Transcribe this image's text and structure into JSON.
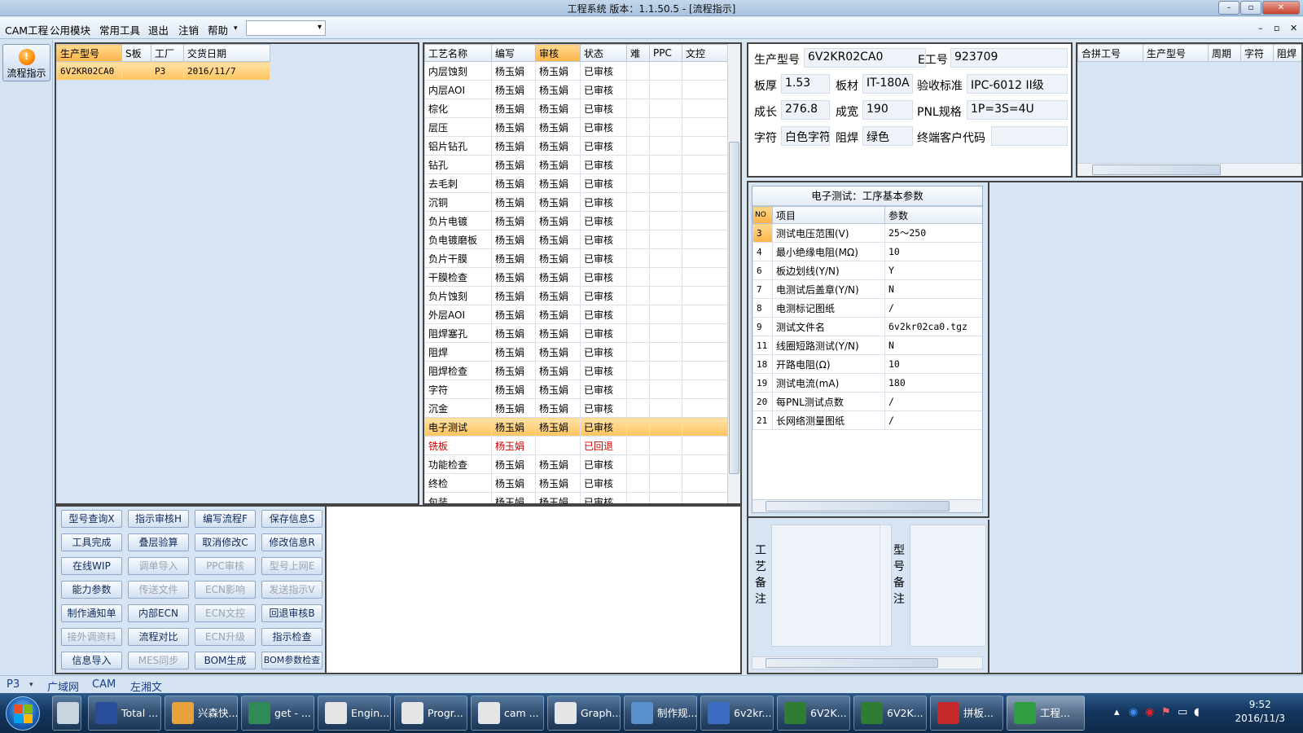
{
  "window": {
    "title": "工程系统  版本：1.1.50.5 - [流程指示]",
    "controls": [
      "–",
      "▫",
      "✕"
    ]
  },
  "menu": {
    "items": [
      "CAM工程",
      "公用模块",
      "常用工具",
      "退出",
      "注销",
      "帮助"
    ],
    "help_arrow": "▾",
    "combo_arrow": "▾",
    "mdi": [
      "–",
      "▫",
      "✕"
    ]
  },
  "sidebar": {
    "flow_label": "流程指示",
    "flow_icon": "!"
  },
  "model_list": {
    "headers": [
      "生产型号",
      "S板",
      "工厂",
      "交货日期"
    ],
    "rows": [
      [
        "6V2KR02CA0",
        "",
        "P3",
        "2016/11/7"
      ]
    ]
  },
  "process": {
    "headers": [
      "工艺名称",
      "编写",
      "审核",
      "状态",
      "难",
      "PPC",
      "文控"
    ],
    "rows": [
      [
        "内层蚀刻",
        "杨玉娟",
        "杨玉娟",
        "已审核"
      ],
      [
        "内层AOI",
        "杨玉娟",
        "杨玉娟",
        "已审核"
      ],
      [
        "棕化",
        "杨玉娟",
        "杨玉娟",
        "已审核"
      ],
      [
        "层压",
        "杨玉娟",
        "杨玉娟",
        "已审核"
      ],
      [
        "铝片钻孔",
        "杨玉娟",
        "杨玉娟",
        "已审核"
      ],
      [
        "钻孔",
        "杨玉娟",
        "杨玉娟",
        "已审核"
      ],
      [
        "去毛刺",
        "杨玉娟",
        "杨玉娟",
        "已审核"
      ],
      [
        "沉铜",
        "杨玉娟",
        "杨玉娟",
        "已审核"
      ],
      [
        "负片电镀",
        "杨玉娟",
        "杨玉娟",
        "已审核"
      ],
      [
        "负电镀磨板",
        "杨玉娟",
        "杨玉娟",
        "已审核"
      ],
      [
        "负片干膜",
        "杨玉娟",
        "杨玉娟",
        "已审核"
      ],
      [
        "干膜检查",
        "杨玉娟",
        "杨玉娟",
        "已审核"
      ],
      [
        "负片蚀刻",
        "杨玉娟",
        "杨玉娟",
        "已审核"
      ],
      [
        "外层AOI",
        "杨玉娟",
        "杨玉娟",
        "已审核"
      ],
      [
        "阻焊塞孔",
        "杨玉娟",
        "杨玉娟",
        "已审核"
      ],
      [
        "阻焊",
        "杨玉娟",
        "杨玉娟",
        "已审核"
      ],
      [
        "阻焊检查",
        "杨玉娟",
        "杨玉娟",
        "已审核"
      ],
      [
        "字符",
        "杨玉娟",
        "杨玉娟",
        "已审核"
      ],
      [
        "沉金",
        "杨玉娟",
        "杨玉娟",
        "已审核"
      ],
      [
        "电子测试",
        "杨玉娟",
        "杨玉娟",
        "已审核"
      ],
      [
        "铣板",
        "杨玉娟",
        "",
        "已回退"
      ],
      [
        "功能检查",
        "杨玉娟",
        "杨玉娟",
        "已审核"
      ],
      [
        "终检",
        "杨玉娟",
        "杨玉娟",
        "已审核"
      ],
      [
        "包装",
        "杨玉娟",
        "杨玉娟",
        "已审核"
      ]
    ],
    "selected_index": 19,
    "rejected_index": 20
  },
  "buttons": [
    [
      "型号查询X",
      "指示审核H",
      "编写流程F",
      "保存信息S"
    ],
    [
      "工具完成",
      "叠层验算",
      "取消修改C",
      "修改信息R"
    ],
    [
      "在线WIP",
      "调单导入",
      "PPC审核",
      "型号上网E"
    ],
    [
      "能力参数",
      "传送文件",
      "ECN影响",
      "发送指示V"
    ],
    [
      "制作通知单",
      "内部ECN",
      "ECN文控",
      "回退审核B"
    ],
    [
      "接外调资料",
      "流程对比",
      "ECN升级",
      "指示检查"
    ],
    [
      "信息导入",
      "MES同步",
      "BOM生成",
      "BOM参数检查"
    ]
  ],
  "disabled_buttons": [
    "调单导入",
    "PPC审核",
    "型号上网E",
    "传送文件",
    "ECN影响",
    "发送指示V",
    "ECN文控",
    "接外调资料",
    "ECN升级",
    "MES同步"
  ],
  "info": {
    "model_label": "生产型号",
    "model": "6V2KR02CA0",
    "eno_label": "E工号",
    "eno": "923709",
    "thick_label": "板厚",
    "thick": "1.53",
    "mat_label": "板材",
    "mat": "IT-180A",
    "std_label": "验收标准",
    "std": "IPC-6012 II级",
    "len_label": "成长",
    "len": "276.8",
    "wid_label": "成宽",
    "wid": "190",
    "pnl_label": "PNL规格",
    "pnl": "1P=3S=4U",
    "char_label": "字符",
    "char": "白色字符",
    "mask_label": "阻焊",
    "mask": "绿色",
    "cust_label": "终端客户代码",
    "cust": ""
  },
  "merge": {
    "headers": [
      "合拼工号",
      "生产型号",
      "周期",
      "字符",
      "阻焊"
    ]
  },
  "etest": {
    "title": "电子测试：工序基本参数",
    "headers": [
      "NO",
      "项目",
      "参数"
    ],
    "rows": [
      [
        "3",
        "测试电压范围(V)",
        "25～250"
      ],
      [
        "4",
        "最小绝缘电阻(MΩ)",
        "10"
      ],
      [
        "6",
        "板边划线(Y/N)",
        "Y"
      ],
      [
        "7",
        "电测试后盖章(Y/N)",
        "N"
      ],
      [
        "8",
        "电测标记图纸",
        "/"
      ],
      [
        "9",
        "测试文件名",
        "6v2kr02ca0.tgz"
      ],
      [
        "11",
        "线圈短路测试(Y/N)",
        "N"
      ],
      [
        "18",
        "开路电阻(Ω)",
        "10"
      ],
      [
        "19",
        "测试电流(mA)",
        "180"
      ],
      [
        "20",
        "每PNL测试点数",
        "/"
      ],
      [
        "21",
        "长网络测量图纸",
        "/"
      ]
    ]
  },
  "remarks": {
    "process_label": [
      "工",
      "艺",
      "备",
      "注"
    ],
    "model_label": [
      "型",
      "号",
      "备",
      "注"
    ]
  },
  "status": {
    "factory": "P3",
    "tabs": [
      "广域网",
      "CAM",
      "左湘文"
    ]
  },
  "taskbar": {
    "items": [
      "Total ...",
      "兴森快...",
      "get - ...",
      "Engin...",
      "Progr...",
      "cam ...",
      "Graph...",
      "制作规...",
      "6v2kr...",
      "6V2K...",
      "6V2K...",
      "拼板...",
      "工程..."
    ],
    "time": "9:52",
    "date": "2016/11/3"
  }
}
